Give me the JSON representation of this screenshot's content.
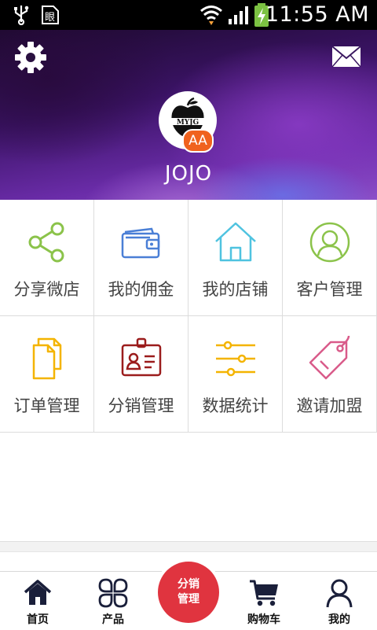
{
  "status_bar": {
    "time": "11:55 AM",
    "icons": [
      "usb-icon",
      "sim-card-icon",
      "wifi-icon",
      "signal-icon",
      "battery-charging-icon"
    ]
  },
  "header": {
    "settings_icon": "gear-icon",
    "message_icon": "mail-icon",
    "avatar_logo_text": "MYJG",
    "badge": "AA",
    "username": "JOJO"
  },
  "grid": {
    "items": [
      {
        "label": "分享微店",
        "icon": "share-icon",
        "color": "#8bc34a"
      },
      {
        "label": "我的佣金",
        "icon": "wallet-icon",
        "color": "#4a7fd6"
      },
      {
        "label": "我的店铺",
        "icon": "house-icon",
        "color": "#4fc3e0"
      },
      {
        "label": "客户管理",
        "icon": "user-circle-icon",
        "color": "#8bc34a"
      },
      {
        "label": "订单管理",
        "icon": "documents-icon",
        "color": "#f4b400"
      },
      {
        "label": "分销管理",
        "icon": "id-badge-icon",
        "color": "#9b1c1c"
      },
      {
        "label": "数据统计",
        "icon": "sliders-icon",
        "color": "#f4b400"
      },
      {
        "label": "邀请加盟",
        "icon": "tag-icon",
        "color": "#d95b8a"
      }
    ]
  },
  "tabbar": {
    "tabs": [
      {
        "label": "首页",
        "icon": "home-icon"
      },
      {
        "label": "产品",
        "icon": "grid-icon"
      },
      {
        "label": "购物车",
        "icon": "cart-icon"
      },
      {
        "label": "我的",
        "icon": "person-icon"
      }
    ],
    "center": {
      "line1": "分销",
      "line2": "管理",
      "color": "#e0343f"
    }
  }
}
